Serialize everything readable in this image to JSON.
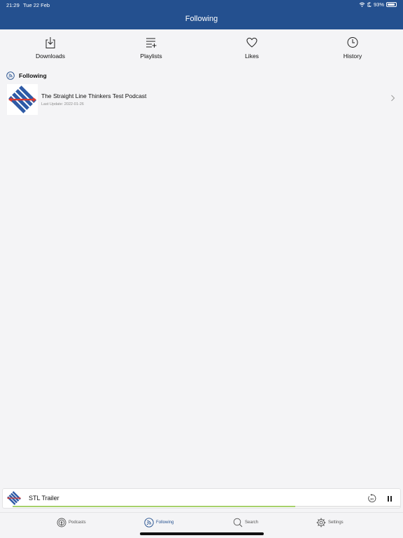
{
  "status_bar": {
    "time": "21:29",
    "date": "Tue 22 Feb",
    "battery": "93%"
  },
  "header": {
    "title": "Following"
  },
  "tabs": [
    {
      "label": "Downloads",
      "icon": "download-icon"
    },
    {
      "label": "Playlists",
      "icon": "playlist-add-icon"
    },
    {
      "label": "Likes",
      "icon": "heart-icon"
    },
    {
      "label": "History",
      "icon": "clock-icon"
    }
  ],
  "section": {
    "title": "Following",
    "icon": "following-icon"
  },
  "podcasts": [
    {
      "title": "The Straight Line Thinkers Test Podcast",
      "last_update": "Last Update: 2022-01-26"
    }
  ],
  "player": {
    "title": "STL Trailer",
    "progress": 0.73,
    "rewind_seconds": "30"
  },
  "bottom_nav": [
    {
      "label": "Podcasts",
      "icon": "podcasts-icon",
      "active": false
    },
    {
      "label": "Following",
      "icon": "following-icon",
      "active": true
    },
    {
      "label": "Search",
      "icon": "search-icon",
      "active": false
    },
    {
      "label": "Settings",
      "icon": "settings-icon",
      "active": false
    }
  ],
  "colors": {
    "brand": "#24508f",
    "progress": "#a6d06b",
    "logo_blue": "#2e5aa6",
    "logo_red": "#d83a33"
  }
}
